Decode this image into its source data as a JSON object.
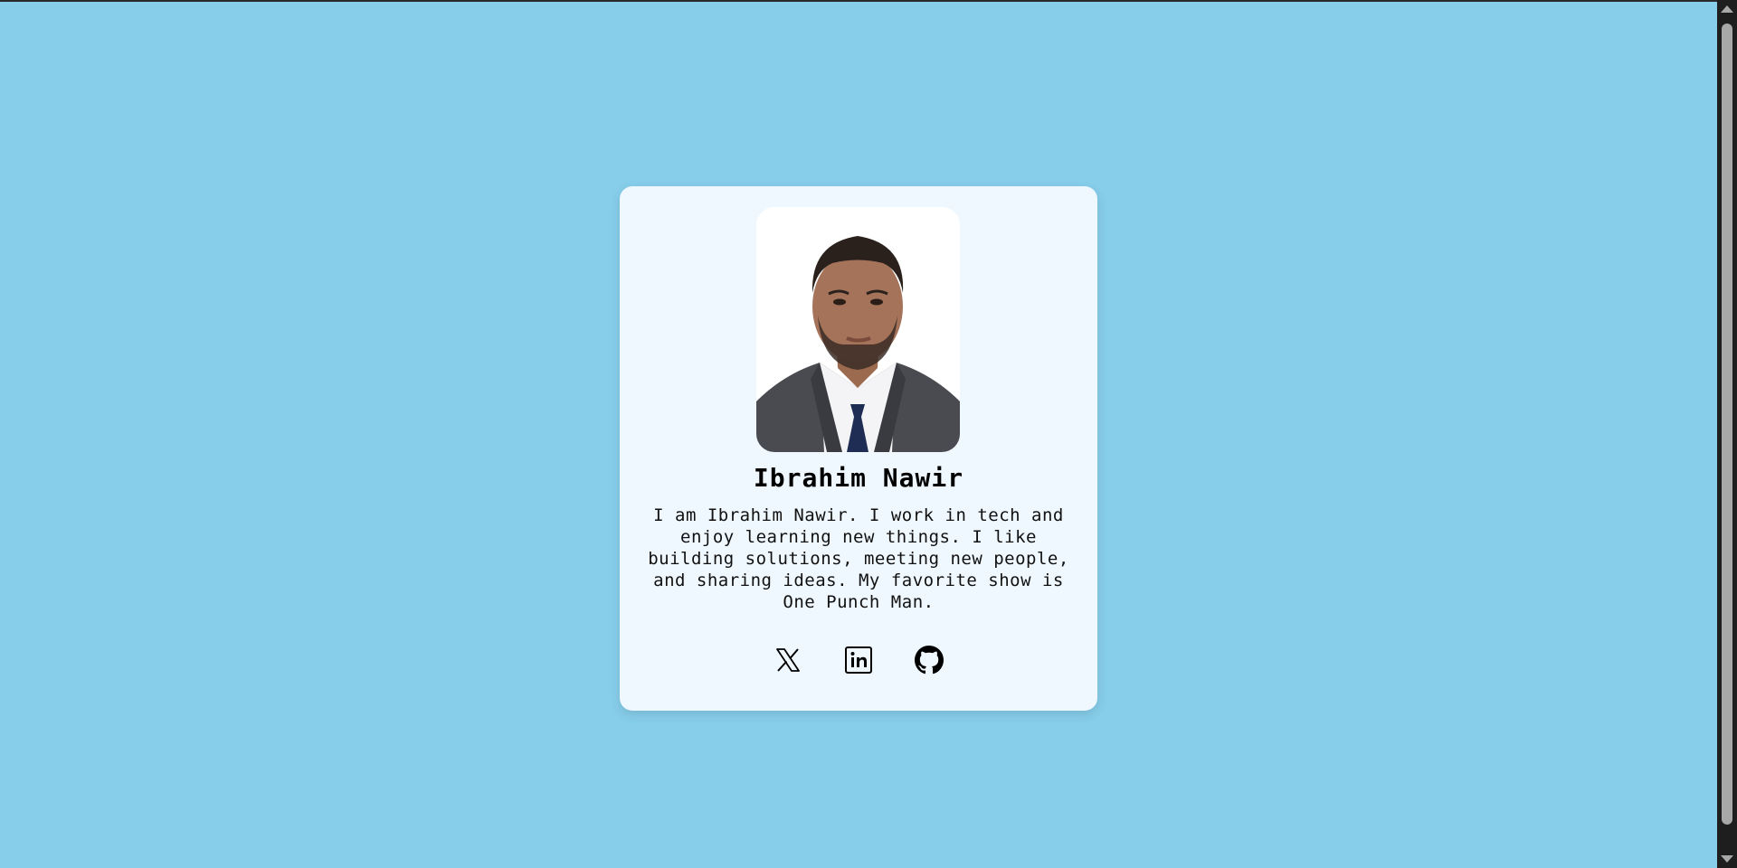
{
  "profile": {
    "photo_alt": "Ibrahim Nawir",
    "name": "Ibrahim Nawir",
    "bio": "I am Ibrahim Nawir. I work in tech and enjoy learning new things. I like building solutions, meeting new people, and sharing ideas. My favorite show is One Punch Man."
  },
  "socials": [
    {
      "icon": "x-icon"
    },
    {
      "icon": "linkedin-icon"
    },
    {
      "icon": "github-icon"
    }
  ],
  "colors": {
    "background": "#87ceeb",
    "card": "#f0f8ff",
    "text": "#000000"
  }
}
